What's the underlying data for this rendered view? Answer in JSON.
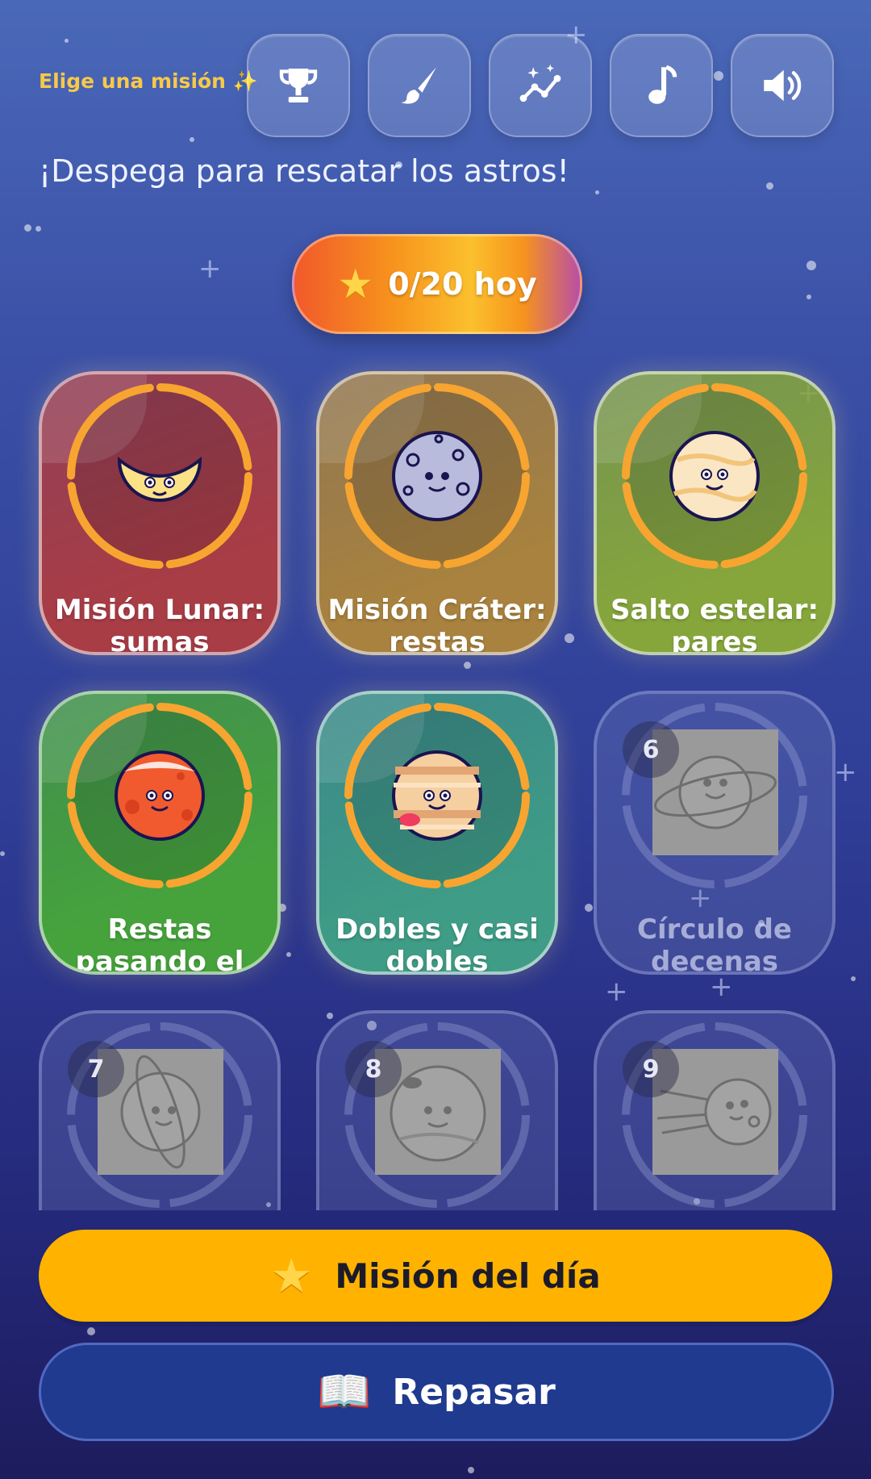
{
  "header": {
    "mission_label": "Elige una misión ✨",
    "buttons": [
      {
        "name": "trophy-icon"
      },
      {
        "name": "paintbrush-icon"
      },
      {
        "name": "constellation-icon"
      },
      {
        "name": "music-note-icon"
      },
      {
        "name": "volume-icon"
      }
    ]
  },
  "subtitle": "¡Despega para rescatar los astros!",
  "progress": {
    "star_icon": "star-icon",
    "text": "0/20 hoy",
    "done": 0,
    "total": 20
  },
  "missions": [
    {
      "title": "Misión Lunar: sumas",
      "color": "#a83d45",
      "face": "moon",
      "locked": false
    },
    {
      "title": "Misión Cráter: restas",
      "color": "#a8823e",
      "face": "crater",
      "locked": false
    },
    {
      "title": "Salto estelar: pares",
      "color": "#86a63c",
      "face": "venus",
      "locked": false
    },
    {
      "title": "Restas pasando el",
      "color": "#46a33c",
      "face": "mars",
      "locked": false
    },
    {
      "title": "Dobles y casi dobles",
      "color": "#3f9c86",
      "face": "jupiter",
      "locked": false
    },
    {
      "title": "Círculo de decenas",
      "number": "6",
      "face": "saturn",
      "locked": true
    },
    {
      "title": "",
      "number": "7",
      "face": "uranus",
      "locked": true
    },
    {
      "title": "",
      "number": "8",
      "face": "neptune",
      "locked": true
    },
    {
      "title": "",
      "number": "9",
      "face": "comet",
      "locked": true
    }
  ],
  "actions": {
    "daily": {
      "label": "Misión del día",
      "icon": "star-icon"
    },
    "review": {
      "label": "Repasar",
      "icon": "book-icon",
      "glyph": "📖"
    }
  },
  "colors": {
    "accent": "#ffb300",
    "review_bg": "#1f3a8e",
    "ring": "#f7a530"
  }
}
